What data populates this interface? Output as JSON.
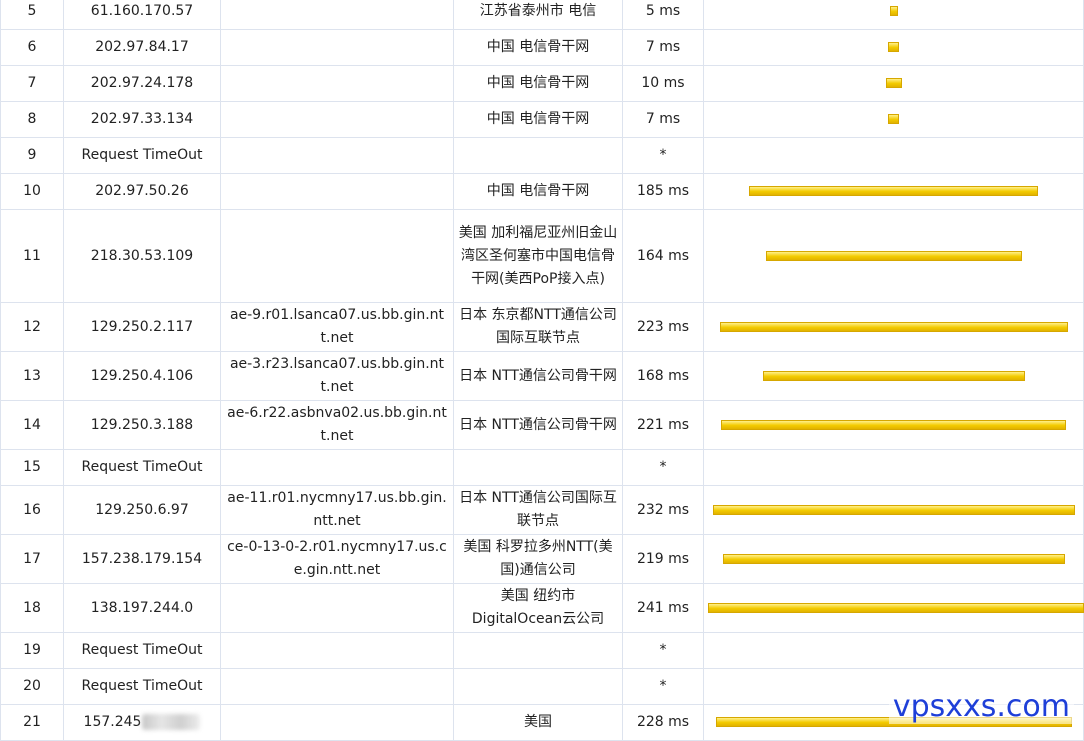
{
  "trace": {
    "rows": [
      {
        "hop": "5",
        "ip": "61.160.170.57",
        "host": "",
        "location": "江苏省泰州市 电信",
        "latency": "5 ms",
        "ms": 5,
        "height": 36
      },
      {
        "hop": "6",
        "ip": "202.97.84.17",
        "host": "",
        "location": "中国 电信骨干网",
        "latency": "7 ms",
        "ms": 7,
        "height": 36
      },
      {
        "hop": "7",
        "ip": "202.97.24.178",
        "host": "",
        "location": "中国 电信骨干网",
        "latency": "10 ms",
        "ms": 10,
        "height": 36
      },
      {
        "hop": "8",
        "ip": "202.97.33.134",
        "host": "",
        "location": "中国 电信骨干网",
        "latency": "7 ms",
        "ms": 7,
        "height": 36
      },
      {
        "hop": "9",
        "ip": "Request TimeOut",
        "host": "",
        "location": "",
        "latency": "*",
        "ms": 0,
        "height": 36
      },
      {
        "hop": "10",
        "ip": "202.97.50.26",
        "host": "",
        "location": "中国 电信骨干网",
        "latency": "185 ms",
        "ms": 185,
        "height": 36
      },
      {
        "hop": "11",
        "ip": "218.30.53.109",
        "host": "",
        "location": "美国 加利福尼亚州旧金山湾区圣何塞市中国电信骨干网(美西PoP接入点)",
        "latency": "164 ms",
        "ms": 164,
        "height": 93
      },
      {
        "hop": "12",
        "ip": "129.250.2.117",
        "host": "ae-9.r01.lsanca07.us.bb.gin.ntt.net",
        "location": "日本 东京都NTT通信公司国际互联节点",
        "latency": "223 ms",
        "ms": 223,
        "height": 49
      },
      {
        "hop": "13",
        "ip": "129.250.4.106",
        "host": "ae-3.r23.lsanca07.us.bb.gin.ntt.net",
        "location": "日本 NTT通信公司骨干网",
        "latency": "168 ms",
        "ms": 168,
        "height": 49
      },
      {
        "hop": "14",
        "ip": "129.250.3.188",
        "host": "ae-6.r22.asbnva02.us.bb.gin.ntt.net",
        "location": "日本 NTT通信公司骨干网",
        "latency": "221 ms",
        "ms": 221,
        "height": 49
      },
      {
        "hop": "15",
        "ip": "Request TimeOut",
        "host": "",
        "location": "",
        "latency": "*",
        "ms": 0,
        "height": 36
      },
      {
        "hop": "16",
        "ip": "129.250.6.97",
        "host": "ae-11.r01.nycmny17.us.bb.gin.ntt.net",
        "location": "日本 NTT通信公司国际互联节点",
        "latency": "232 ms",
        "ms": 232,
        "height": 49
      },
      {
        "hop": "17",
        "ip": "157.238.179.154",
        "host": "ce-0-13-0-2.r01.nycmny17.us.ce.gin.ntt.net",
        "location": "美国 科罗拉多州NTT(美国)通信公司",
        "latency": "219 ms",
        "ms": 219,
        "height": 49
      },
      {
        "hop": "18",
        "ip": "138.197.244.0",
        "host": "",
        "location": "美国 纽约市DigitalOcean云公司",
        "latency": "241 ms",
        "ms": 241,
        "height": 49
      },
      {
        "hop": "19",
        "ip": "Request TimeOut",
        "host": "",
        "location": "",
        "latency": "*",
        "ms": 0,
        "height": 36
      },
      {
        "hop": "20",
        "ip": "Request TimeOut",
        "host": "",
        "location": "",
        "latency": "*",
        "ms": 0,
        "height": 36
      },
      {
        "hop": "21",
        "ip": "157.245",
        "host": "",
        "location": "美国",
        "latency": "228 ms",
        "ms": 228,
        "height": 36,
        "masked": true
      }
    ]
  },
  "watermark": {
    "text": "vpsxxs.com"
  },
  "colors": {
    "bar": "#f3cb00",
    "border": "#dde3ee",
    "watermark": "#1e3fd8"
  }
}
